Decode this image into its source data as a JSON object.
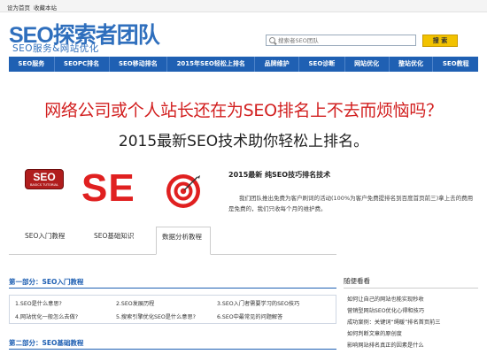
{
  "topbar": {
    "set_home": "设为首页",
    "bookmark": "收藏本站"
  },
  "logo": {
    "main": "SEO探索者团队",
    "sub": "SEO服务&网站优化"
  },
  "search": {
    "placeholder": "搜索者SEO团队",
    "button": "搜 索"
  },
  "nav": [
    "SEO服务",
    "SEOPC排名",
    "SEO移动排名",
    "2015年SEO轻松上排名",
    "品牌维护",
    "SEO诊断",
    "网站优化",
    "整站优化",
    "SEO教程"
  ],
  "banner": {
    "line1": "网络公司或个人站长还在为SEO排名上不去而烦恼吗？",
    "line2": "2015最新SEO技术助你轻松上排名。"
  },
  "hero": {
    "badge_text": "SEO",
    "badge_sub": "BASICS TUTORIAL",
    "big_text": "SE",
    "info_title": "2015最新  纯SEO技巧排名技术",
    "info_text": "我们团队推出免费为客户刷词的活动(100%为客户免费提排名到百度首页前三)拿上去的费用是免费的，我们只收每个月的维护费。"
  },
  "tabs": [
    "SEO入门教程",
    "SEO基础知识",
    "数据分析教程"
  ],
  "section1": {
    "title": "第一部分：SEO入门教程",
    "links": [
      "1.SEO是什么意思?",
      "2.SEO发展历程",
      "3.SEO入门者需要学习的SEO技巧",
      "4.网站优化一般怎么去做?",
      "5.搜索引擎优化SEO是什么意思?",
      "6.SEO中最常见的问题解答"
    ]
  },
  "section2": {
    "title": "第二部分：SEO基础教程"
  },
  "sidebar": {
    "title": "随便看看",
    "items": [
      "如何让自己的网站也能实现秒收",
      "营销型网站SEO优化心得和技巧",
      "成功案例：关键词“绳暖”排名首页前三",
      "如何判断文章的原创度",
      "影响网站排名真正的因素是什么"
    ]
  },
  "colors": {
    "nav": "#1f60b3",
    "banner_red": "#d21f1f",
    "accent_yellow": "#f2c200"
  }
}
